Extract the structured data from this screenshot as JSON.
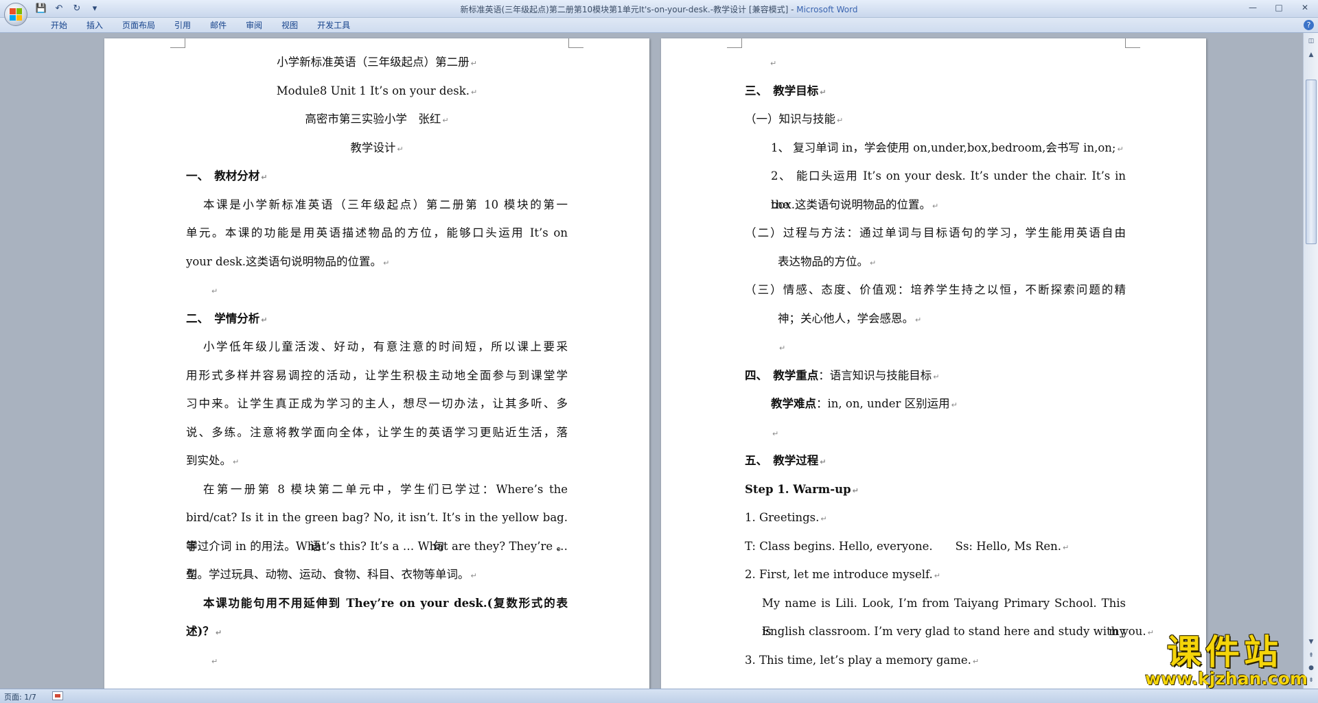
{
  "window": {
    "title": "新标准英语(三年级起点)第二册第10模块第1单元It's-on-your-desk.-教学设计 [兼容模式] - ",
    "app_name": "Microsoft Word",
    "minimize": "—",
    "maximize": "□",
    "close": "✕"
  },
  "ribbon": {
    "tabs": [
      "开始",
      "插入",
      "页面布局",
      "引用",
      "邮件",
      "审阅",
      "视图",
      "开发工具"
    ],
    "help": "?"
  },
  "quick_access": {
    "save_icon": "💾",
    "undo_icon": "↶",
    "redo_icon": "↻",
    "customize_icon": "▾"
  },
  "paragraph_mark": "↵",
  "left_page": {
    "header_line1": "小学新标准英语（三年级起点）第二册",
    "header_line2": "Module8 Unit 1 It’s on your desk.",
    "header_line3": "高密市第三实验小学　张红",
    "header_line4": "教学设计",
    "sec1_title": "一、　教材分材",
    "sec1_p1_l1": "本课是小学新标准英语（三年级起点）第二册第 10 模块的第一",
    "sec1_p1_l2": "单元。本课的功能是用英语描述物品的方位，能够口头运用 It’s on",
    "sec1_p1_l3": "your desk.这类语句说明物品的位置。",
    "sec2_title": "二、　学情分析",
    "sec2_p1_l1": "小学低年级儿童活泼、好动，有意注意的时间短，所以课上要采",
    "sec2_p1_l2": "用形式多样并容易调控的活动，让学生积极主动地全面参与到课堂学",
    "sec2_p1_l3": "习中来。让学生真正成为学习的主人，想尽一切办法，让其多听、多",
    "sec2_p1_l4": "说、多练。注意将教学面向全体，让学生的英语学习更贴近生活，落",
    "sec2_p1_l5": "到实处。",
    "sec2_p2_l1": "在第一册第 8 模块第二单元中，学生们已学过：Where’s the",
    "sec2_p2_l2": "bird/cat? Is it in the green bag? No, it isn’t. It’s in the yellow bag.等语句。",
    "sec2_p2_l3": "学过介词 in 的用法。What’s this? It’s a … What are they? They’re … 句",
    "sec2_p2_l4": "型。学过玩具、动物、运动、食物、科目、衣物等单词。",
    "sec2_p3_l1": "本课功能句用不用延伸到 They’re on your desk.(复数形式的表",
    "sec2_p3_l2": "述)？"
  },
  "right_page": {
    "sec3_title": "三、　教学目标",
    "sec3_a": "（一）知识与技能",
    "sec3_a1": "1、 复习单词 in，学会使用 on,under,box,bedroom,会书写 in,on;",
    "sec3_a2_l1": "2、 能口头运用 It’s on your desk. It’s under the chair. It’s in the",
    "sec3_a2_l2": "box.这类语句说明物品的位置。",
    "sec3_b_l1": "（二）过程与方法：通过单词与目标语句的学习，学生能用英语自由",
    "sec3_b_l2": "表达物品的方位。",
    "sec3_c_l1": "（三）情感、态度、价值观：培养学生持之以恒，不断探索问题的精",
    "sec3_c_l2": "神；关心他人，学会感恩。",
    "sec4_label": "四、　教学重点",
    "sec4_text": "：语言知识与技能目标",
    "sec4b_label": "教学难点",
    "sec4b_text": "：in, on, under 区别运用",
    "sec5_title": "五、　教学过程",
    "step1": "Step 1. Warm-up",
    "item1": "1.  Greetings.",
    "dialog1": "T: Class begins. Hello, everyone.　　Ss: Hello, Ms Ren.",
    "item2": "2.  First, let me introduce myself.",
    "intro_l1": "My name is Lili. Look, I’m from Taiyang Primary School. This is my",
    "intro_l2": "English classroom. I’m very glad to stand here and study with you.",
    "item3": "3.  This time, let’s play a memory game."
  },
  "status": {
    "page_info": "页面: 1/7"
  },
  "watermark": {
    "title": "课件站",
    "url": "www.kjzhan.com"
  },
  "colors": {
    "accent": "#15428b",
    "app_name": "#3a64b0",
    "watermark": "#f5d50a"
  }
}
